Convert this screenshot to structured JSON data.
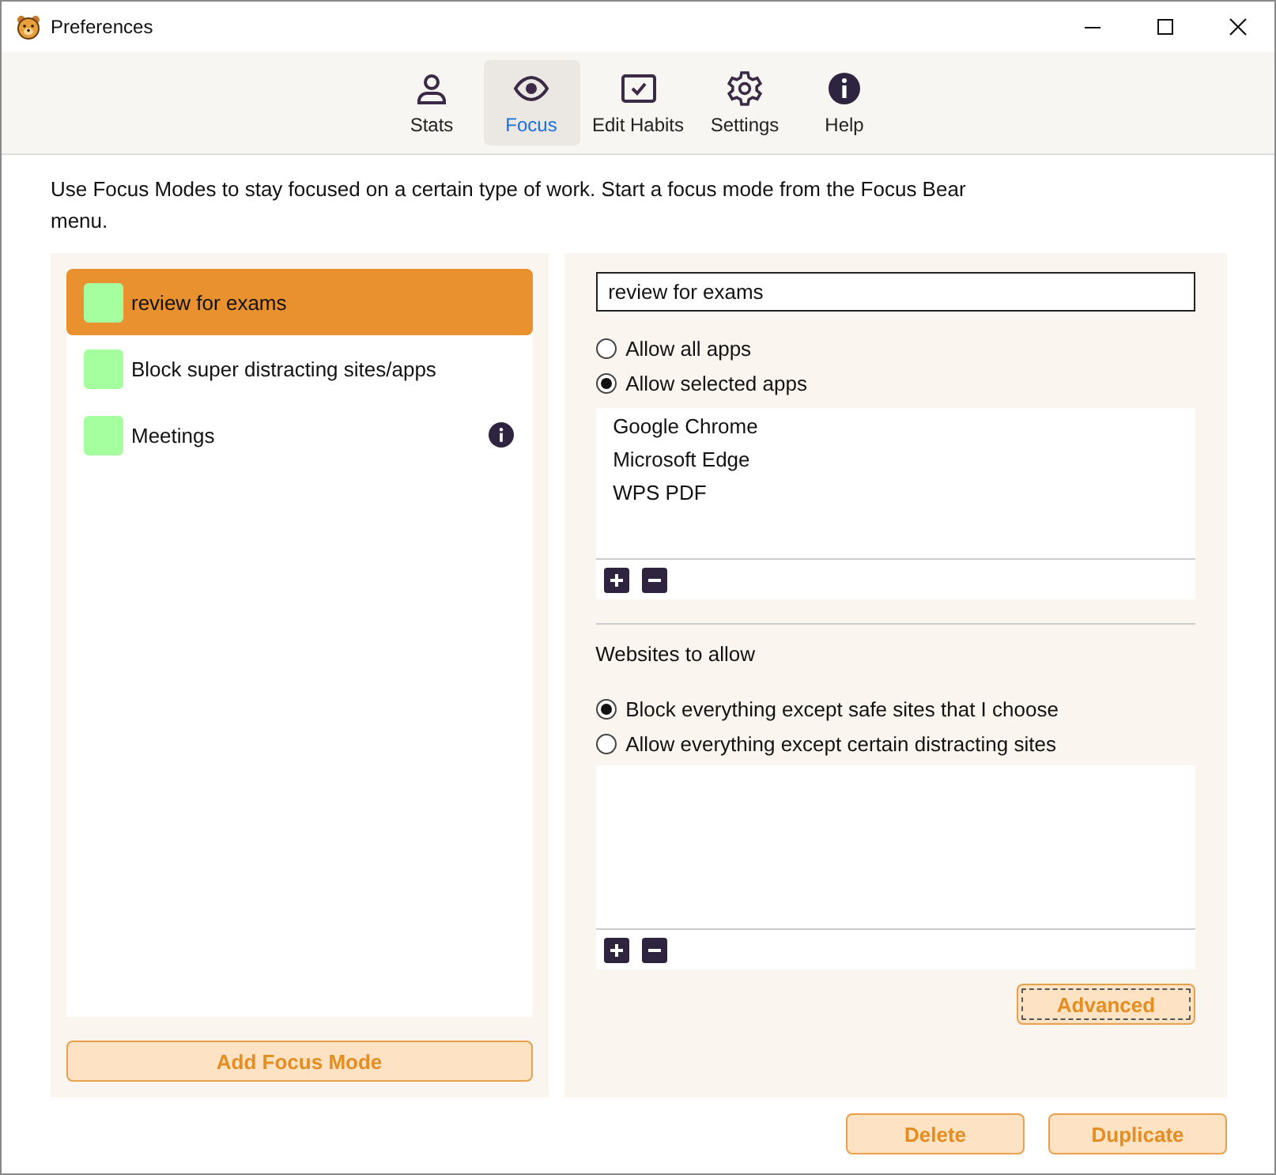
{
  "window": {
    "title": "Preferences"
  },
  "tabs": [
    {
      "label": "Stats",
      "selected": false
    },
    {
      "label": "Focus",
      "selected": true
    },
    {
      "label": "Edit Habits",
      "selected": false
    },
    {
      "label": "Settings",
      "selected": false
    },
    {
      "label": "Help",
      "selected": false
    }
  ],
  "description": "Use Focus Modes to stay focused on a certain type of work. Start a focus mode from the Focus Bear menu.",
  "modes": [
    {
      "name": "review for exams",
      "color": "#a6ff9f",
      "selected": true,
      "info": false
    },
    {
      "name": "Block super distracting sites/apps",
      "color": "#a6ff9f",
      "selected": false,
      "info": false
    },
    {
      "name": "Meetings",
      "color": "#a6ff9f",
      "selected": false,
      "info": true
    }
  ],
  "add_button": "Add Focus Mode",
  "editor": {
    "name_value": "review for exams",
    "app_options": [
      {
        "label": "Allow all apps",
        "selected": false
      },
      {
        "label": "Allow selected apps",
        "selected": true
      }
    ],
    "apps": [
      "Google Chrome",
      "Microsoft Edge",
      "WPS PDF"
    ],
    "websites_heading": "Websites to allow",
    "site_options": [
      {
        "label": "Block everything except safe sites that I choose",
        "selected": true
      },
      {
        "label": "Allow everything except certain distracting sites",
        "selected": false
      }
    ],
    "advanced_button": "Advanced"
  },
  "buttons": [
    "Delete",
    "Duplicate"
  ]
}
